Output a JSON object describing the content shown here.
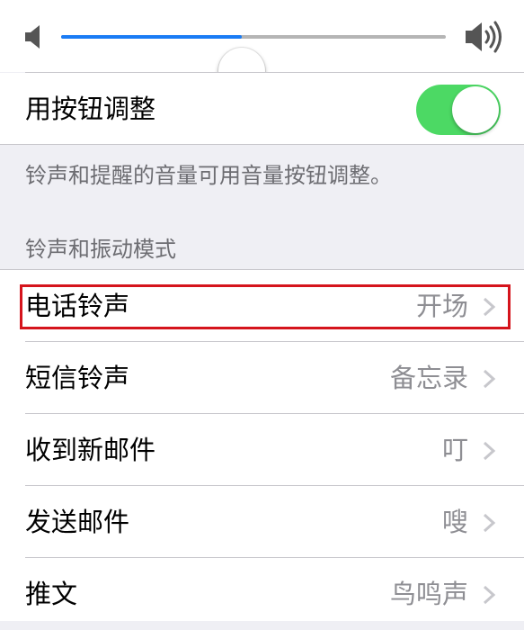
{
  "volume": {
    "level": 0.47,
    "low_icon": "speaker-low-icon",
    "high_icon": "speaker-high-icon",
    "accent_color": "#1a7cf5"
  },
  "change_with_buttons": {
    "label": "用按钮调整",
    "enabled": true,
    "toggle_color": "#4cd964"
  },
  "footer_note": "铃声和提醒的音量可用音量按钮调整。",
  "section_header": "铃声和振动模式",
  "sounds": [
    {
      "label": "电话铃声",
      "value": "开场"
    },
    {
      "label": "短信铃声",
      "value": "备忘录"
    },
    {
      "label": "收到新邮件",
      "value": "叮"
    },
    {
      "label": "发送邮件",
      "value": "嗖"
    },
    {
      "label": "推文",
      "value": "鸟鸣声"
    }
  ],
  "highlight_color": "#d5141c"
}
